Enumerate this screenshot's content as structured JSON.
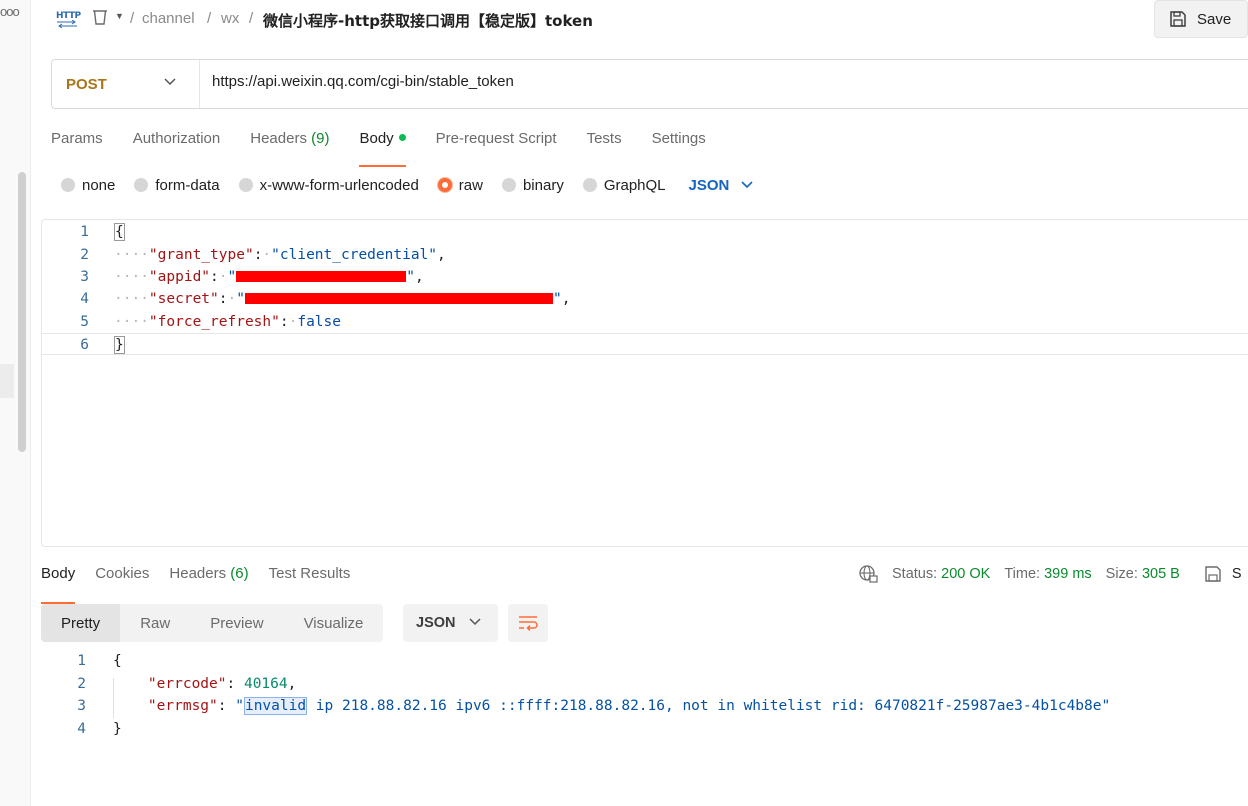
{
  "breadcrumb": {
    "http_badge": "HTTP",
    "sep": "/",
    "items": [
      "channel",
      "wx"
    ],
    "title": "微信小程序-http获取接口调用【稳定版】token"
  },
  "toolbar": {
    "save_label": "Save"
  },
  "request": {
    "method": "POST",
    "url": "https://api.weixin.qq.com/cgi-bin/stable_token"
  },
  "request_tabs": [
    {
      "label": "Params"
    },
    {
      "label": "Authorization"
    },
    {
      "label": "Headers",
      "count": "(9)"
    },
    {
      "label": "Body",
      "active": true
    },
    {
      "label": "Pre-request Script"
    },
    {
      "label": "Tests"
    },
    {
      "label": "Settings"
    }
  ],
  "body_types": [
    "none",
    "form-data",
    "x-www-form-urlencoded",
    "raw",
    "binary",
    "GraphQL"
  ],
  "body_type_selected": "raw",
  "body_language": "JSON",
  "editor": {
    "line_numbers": [
      "1",
      "2",
      "3",
      "4",
      "5",
      "6"
    ],
    "open_brace": "{",
    "close_brace": "}",
    "grant_type_key": "\"grant_type\"",
    "grant_type_value": "\"client_credential\"",
    "appid_key": "\"appid\"",
    "appid_value_prefix": "\"",
    "appid_value_suffix": "\"",
    "secret_key": "\"secret\"",
    "secret_value_prefix": "\"",
    "secret_value_suffix": "\"",
    "force_refresh_key": "\"force_refresh\"",
    "force_refresh_value": "false"
  },
  "response_tabs": [
    {
      "label": "Body",
      "active": true
    },
    {
      "label": "Cookies"
    },
    {
      "label": "Headers",
      "count": "(6)"
    },
    {
      "label": "Test Results"
    }
  ],
  "response_meta": {
    "status_label": "Status:",
    "status_value": "200 OK",
    "time_label": "Time:",
    "time_value": "399 ms",
    "size_label": "Size:",
    "size_value": "305 B",
    "save_cut": "S"
  },
  "response_views": [
    "Pretty",
    "Raw",
    "Preview",
    "Visualize"
  ],
  "response_view_selected": "Pretty",
  "response_language": "JSON",
  "response_body": {
    "line_numbers": [
      "1",
      "2",
      "3",
      "4"
    ],
    "open_brace": "{",
    "close_brace": "}",
    "errcode_key": "\"errcode\"",
    "errcode_value": "40164",
    "errmsg_key": "\"errmsg\"",
    "errmsg_quote": "\"",
    "errmsg_highlight": "invalid",
    "errmsg_rest": " ip 218.88.82.16 ipv6 ::ffff:218.88.82.16, not in whitelist rid: 6470821f-25987ae3-4b1c4b8e\""
  },
  "colors": {
    "accent": "#ff6c37",
    "method": "#a8751a",
    "status_green": "#0a8a2d",
    "json_blue": "#1565c0"
  },
  "icons": [
    "http-icon",
    "collection-icon",
    "save-icon",
    "chevron-down-icon",
    "globe-lock-icon",
    "wrap-lines-icon"
  ]
}
